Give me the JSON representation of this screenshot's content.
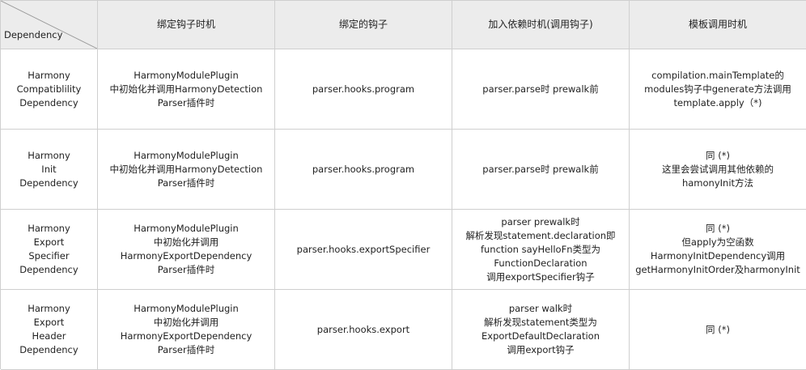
{
  "table": {
    "corner_label": "Dependency",
    "headers": [
      "绑定钩子时机",
      "绑定的钩子",
      "加入依赖时机(调用钩子)",
      "模板调用时机"
    ],
    "rows": [
      {
        "name": "Harmony\nCompatiblility\nDependency",
        "cells": [
          "HarmonyModulePlugin\n中初始化并调用HarmonyDetection\nParser插件时",
          "parser.hooks.program",
          "parser.parse时 prewalk前",
          "compilation.mainTemplate的\nmodules钩子中generate方法调用\ntemplate.apply（*)"
        ]
      },
      {
        "name": "Harmony\nInit\nDependency",
        "cells": [
          "HarmonyModulePlugin\n中初始化并调用HarmonyDetection\nParser插件时",
          "parser.hooks.program",
          "parser.parse时 prewalk前",
          "同 (*)\n这里会尝试调用其他依赖的\nhamonyInit方法"
        ]
      },
      {
        "name": "Harmony\nExport\nSpecifier\nDependency",
        "cells": [
          "HarmonyModulePlugin\n中初始化并调用\nHarmonyExportDependency\nParser插件时",
          "parser.hooks.exportSpecifier",
          "parser prewalk时\n解析发现statement.declaration即\nfunction sayHelloFn类型为\nFunctionDeclaration\n调用exportSpecifier钩子",
          "同 (*)\n但apply为空函数\nHarmonyInitDependency调用\ngetHarmonyInitOrder及harmonyInit"
        ]
      },
      {
        "name": "Harmony\nExport\nHeader\nDependency",
        "cells": [
          "HarmonyModulePlugin\n中初始化并调用\nHarmonyExportDependency\nParser插件时",
          "parser.hooks.export",
          "parser walk时\n解析发现statement类型为\nExportDefaultDeclaration\n调用export钩子",
          "同 (*)"
        ]
      }
    ]
  }
}
